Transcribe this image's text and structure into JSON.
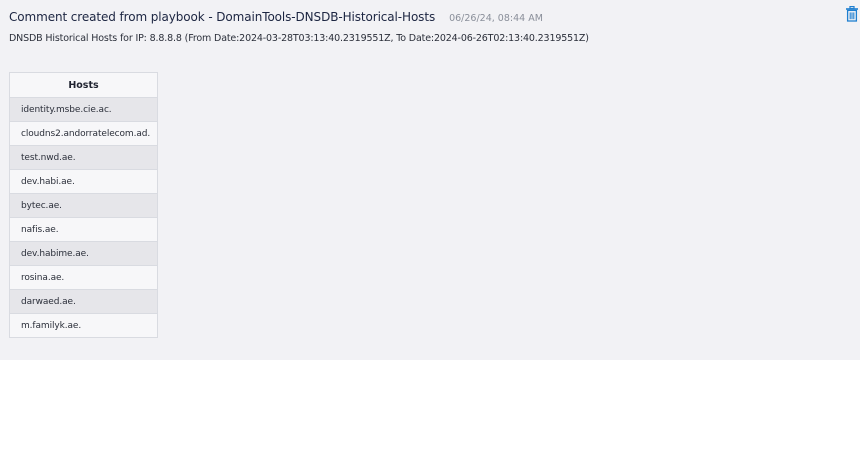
{
  "comment": {
    "title": "Comment created from playbook - DomainTools-DNSDB-Historical-Hosts",
    "timestamp": "06/26/24, 08:44 AM",
    "description": "DNSDB Historical Hosts for IP: 8.8.8.8 (From Date:2024-03-28T03:13:40.2319551Z, To Date:2024-06-26T02:13:40.2319551Z)",
    "delete_icon": "trash-icon",
    "accent_color": "#1f7fd0"
  },
  "table": {
    "header": "Hosts",
    "rows": [
      "identity.msbe.cie.ac.",
      "cloudns2.andorratelecom.ad.",
      "test.nwd.ae.",
      "dev.habi.ae.",
      "bytec.ae.",
      "nafis.ae.",
      "dev.habime.ae.",
      "rosina.ae.",
      "darwaed.ae.",
      "m.familyk.ae."
    ]
  }
}
